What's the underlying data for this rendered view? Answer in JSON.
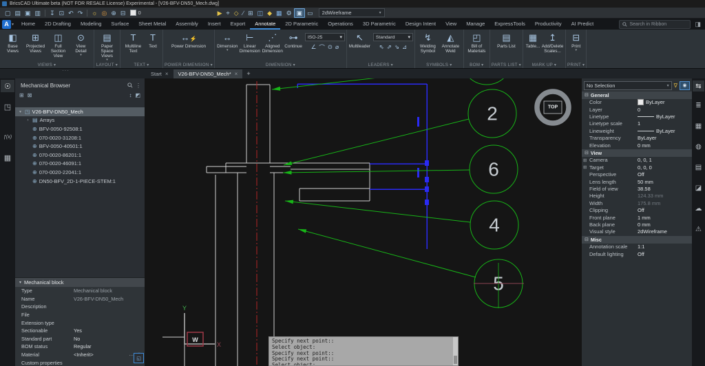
{
  "window": {
    "title": "BricsCAD Ultimate beta (NOT FOR RESALE License) Experimental - [V26-BFV-DN50_Mech.dwg]"
  },
  "qat": {
    "layer_value": "0",
    "visual_style": "2dWireframe",
    "left_icons": [
      {
        "name": "new-file-icon",
        "glyph": "▢"
      },
      {
        "name": "open-file-icon",
        "glyph": "▤"
      },
      {
        "name": "save-icon",
        "glyph": "▣"
      },
      {
        "name": "save-all-icon",
        "glyph": "▥"
      },
      {
        "name": "sep"
      },
      {
        "name": "import-icon",
        "glyph": "↧"
      },
      {
        "name": "export-icon",
        "glyph": "⊡"
      },
      {
        "name": "undo-icon",
        "glyph": "↶"
      },
      {
        "name": "redo-icon",
        "glyph": "↷"
      },
      {
        "name": "sep"
      },
      {
        "name": "tips-icon",
        "glyph": "☼",
        "color": "#e6c04a"
      },
      {
        "name": "target-icon",
        "glyph": "◎",
        "color": "#e09a3e"
      },
      {
        "name": "snap-marker-icon",
        "glyph": "⊕"
      },
      {
        "name": "plot-icon",
        "glyph": "⊟"
      }
    ],
    "right_icons": [
      {
        "name": "cursor-icon",
        "glyph": "▶",
        "color": "#e3c34a"
      },
      {
        "name": "crosshair-icon",
        "glyph": "⌖"
      },
      {
        "name": "entity-snap-icon",
        "glyph": "◇",
        "color": "#e3c34a"
      },
      {
        "name": "sketch-icon",
        "glyph": "∕"
      },
      {
        "name": "grid-icon",
        "glyph": "⊞"
      },
      {
        "name": "panels-icon",
        "glyph": "◫",
        "color": "#7fb2e5"
      },
      {
        "name": "effects-icon",
        "glyph": "◆",
        "color": "#e3c34a"
      },
      {
        "name": "table-icon",
        "glyph": "▦",
        "color": "#7fb2e5"
      },
      {
        "name": "settings-icon",
        "glyph": "⚙"
      },
      {
        "name": "current-view-icon",
        "glyph": "▣",
        "active": true,
        "color": "#cfe2f2"
      },
      {
        "name": "monitor-icon",
        "glyph": "▭"
      }
    ]
  },
  "ribbon": {
    "active_tab": "Annotate",
    "search_placeholder": "Search in Ribbon",
    "tabs": [
      "Home",
      "2D Drafting",
      "Modeling",
      "Surface",
      "Sheet Metal",
      "Assembly",
      "Insert",
      "Export",
      "Annotate",
      "2D Parametric",
      "Operations",
      "3D Parametric",
      "Design Intent",
      "View",
      "Manage",
      "ExpressTools",
      "Productivity",
      "AI Predict"
    ],
    "groups": [
      {
        "label": "VIEWS",
        "buttons": [
          {
            "label": "Base Views",
            "glyph": "◧"
          },
          {
            "label": "Projected Views",
            "glyph": "⊞"
          },
          {
            "label": "Full Section View",
            "glyph": "◫"
          },
          {
            "label": "View Detail",
            "glyph": "⊙",
            "caret": true
          }
        ]
      },
      {
        "label": "LAYOUT",
        "buttons": [
          {
            "label": "Paper Space Views",
            "glyph": "▤",
            "caret": true
          }
        ]
      },
      {
        "label": "TEXT",
        "buttons": [
          {
            "label": "Multiline Text",
            "glyph": "T"
          },
          {
            "label": "Text",
            "glyph": "T"
          }
        ]
      },
      {
        "label": "POWER DIMENSION",
        "buttons": [
          {
            "label": "Power Dimension",
            "glyph": "↔",
            "wide": true,
            "spark": "⚡"
          }
        ]
      },
      {
        "label": "DIMENSION",
        "buttons": [
          {
            "label": "Dimension",
            "glyph": "↔",
            "caret": true
          },
          {
            "label": "Linear Dimension",
            "glyph": "⊢"
          },
          {
            "label": "Aligned Dimension",
            "glyph": "⋰"
          },
          {
            "label": "Continue",
            "glyph": "⊶"
          }
        ],
        "side": {
          "dropdown": "ISO-25",
          "icons": [
            "∠",
            "⌒",
            "⊙",
            "⌀"
          ]
        }
      },
      {
        "label": "LEADERS",
        "buttons": [
          {
            "label": "Multileader",
            "glyph": "↖"
          }
        ],
        "side": {
          "dropdown": "Standard",
          "icons": [
            "⇖",
            "⇗",
            "⇘",
            "⊿"
          ]
        }
      },
      {
        "label": "SYMBOLS",
        "buttons": [
          {
            "label": "Welding Symbol",
            "glyph": "↯"
          },
          {
            "label": "Annotate Weld",
            "glyph": "◭"
          }
        ]
      },
      {
        "label": "BOM",
        "buttons": [
          {
            "label": "Bill of Materials",
            "glyph": "◰"
          }
        ]
      },
      {
        "label": "PARTS LIST",
        "buttons": [
          {
            "label": "Parts List",
            "glyph": "▤"
          }
        ]
      },
      {
        "label": "MARK UP",
        "buttons": [
          {
            "label": "Table...",
            "glyph": "▦"
          },
          {
            "label": "Add/Delete Scales...",
            "glyph": "↥"
          }
        ]
      },
      {
        "label": "PRINT",
        "buttons": [
          {
            "label": "Print",
            "glyph": "⊟",
            "caret": true
          }
        ]
      }
    ]
  },
  "doc_tabs": {
    "add_label": "+",
    "tabs": [
      {
        "label": "Start",
        "active": false
      },
      {
        "label": "V26-BFV-DN50_Mech*",
        "active": true
      }
    ]
  },
  "left_strip": [
    {
      "name": "light-panel-icon",
      "glyph": "☉",
      "active": true,
      "gap": 2
    },
    {
      "name": "solids-browser-icon",
      "glyph": "◳",
      "gap": 12
    },
    {
      "name": "parameters-panel-icon",
      "glyph": "ƒ(x)",
      "small": true,
      "gap": 26
    },
    {
      "name": "structure-panel-icon",
      "glyph": "▦",
      "gap": 12
    }
  ],
  "browser": {
    "title": "Mechanical Browser",
    "tools": [
      {
        "name": "mech-symbols-icon",
        "glyph": "⊞",
        "side": "left"
      },
      {
        "name": "bom-status-icon",
        "glyph": "⊠",
        "side": "left"
      },
      {
        "name": "expand-levels-icon",
        "glyph": "↕",
        "side": "right"
      },
      {
        "name": "highlight-mode-icon",
        "glyph": "◩",
        "side": "right"
      }
    ],
    "tree": [
      {
        "label": "V26-BFV-DN50_Mech",
        "level": 0,
        "icon": "assembly",
        "caret": "▾",
        "selected": true
      },
      {
        "label": "Arrays",
        "level": 1,
        "icon": "folder",
        "caret": "›",
        "selected": false
      },
      {
        "label": "BFV-0050-92508:1",
        "level": 1,
        "icon": "part",
        "caret": "",
        "selected": false
      },
      {
        "label": "070-0020-31208:1",
        "level": 1,
        "icon": "part",
        "caret": "",
        "selected": false
      },
      {
        "label": "BFV-0050-40501:1",
        "level": 1,
        "icon": "part",
        "caret": "",
        "selected": false
      },
      {
        "label": "070-0020-86201:1",
        "level": 1,
        "icon": "part",
        "caret": "",
        "selected": false
      },
      {
        "label": "070-0020-46091:1",
        "level": 1,
        "icon": "part",
        "caret": "",
        "selected": false
      },
      {
        "label": "070-0020-22041:1",
        "level": 1,
        "icon": "part",
        "caret": "",
        "selected": false
      },
      {
        "label": "DN50-BFV_2D-1-PIECE-STEM:1",
        "level": 1,
        "icon": "part",
        "caret": "",
        "selected": false
      }
    ]
  },
  "block_props": {
    "title": "Mechanical block",
    "rows": [
      {
        "label": "Type",
        "value": "Mechanical block",
        "gray": true
      },
      {
        "label": "Name",
        "value": "V26-BFV-DN50_Mech",
        "gray": true
      },
      {
        "label": "Description",
        "value": ""
      },
      {
        "label": "File",
        "value": ""
      },
      {
        "label": "Extension type",
        "value": ""
      },
      {
        "label": "Sectionable",
        "value": "Yes"
      },
      {
        "label": "Standard part",
        "value": "No"
      },
      {
        "label": "BOM status",
        "value": "Regular"
      },
      {
        "label": "Material",
        "value": "<Inherit>",
        "actions": true
      },
      {
        "label": "Custom properties",
        "value": ""
      }
    ]
  },
  "properties": {
    "selection": "No Selection",
    "sections": [
      {
        "title": "General",
        "rows": [
          {
            "label": "Color",
            "value": "ByLayer",
            "swatch": true
          },
          {
            "label": "Layer",
            "value": "0"
          },
          {
            "label": "Linetype",
            "value": "ByLayer",
            "line": true
          },
          {
            "label": "Linetype scale",
            "value": "1"
          },
          {
            "label": "Lineweight",
            "value": "ByLayer",
            "line": true
          },
          {
            "label": "Transparency",
            "value": "ByLayer"
          },
          {
            "label": "Elevation",
            "value": "0 mm"
          }
        ]
      },
      {
        "title": "View",
        "rows": [
          {
            "label": "Camera",
            "value": "0, 0, 1",
            "expand": true
          },
          {
            "label": "Target",
            "value": "0, 0, 0",
            "expand": true
          },
          {
            "label": "Perspective",
            "value": "Off"
          },
          {
            "label": "Lens length",
            "value": "50 mm"
          },
          {
            "label": "Field of view",
            "value": "38.58"
          },
          {
            "label": "Height",
            "value": "124.33 mm",
            "disabled": true
          },
          {
            "label": "Width",
            "value": "175.8 mm",
            "disabled": true
          },
          {
            "label": "Clipping",
            "value": "Off"
          },
          {
            "label": "Front plane",
            "value": "1 mm"
          },
          {
            "label": "Back plane",
            "value": "0 mm"
          },
          {
            "label": "Visual style",
            "value": "2dWireframe"
          }
        ]
      },
      {
        "title": "Misc",
        "rows": [
          {
            "label": "Annotation scale",
            "value": "1:1"
          },
          {
            "label": "Default lighting",
            "value": "Off"
          }
        ]
      }
    ]
  },
  "right_strip": [
    {
      "name": "properties-panel-icon",
      "glyph": "⇆",
      "active": true
    },
    {
      "name": "layers-panel-icon",
      "glyph": "≣"
    },
    {
      "name": "blocks-panel-icon",
      "glyph": "▦"
    },
    {
      "name": "assistant-panel-icon",
      "glyph": "◍"
    },
    {
      "name": "table-panel-icon",
      "glyph": "▤"
    },
    {
      "name": "sheets-panel-icon",
      "glyph": "◪"
    },
    {
      "name": "cloud-panel-icon",
      "glyph": "☁"
    },
    {
      "name": "warnings-panel-icon",
      "glyph": "⚠"
    }
  ],
  "command_line": {
    "lines": [
      "Specify next point::",
      "Select object:",
      "Specify next point::",
      "Specify next point::",
      "Select object:"
    ]
  },
  "canvas": {
    "view_label": "TOP",
    "balloons": [
      "2",
      "6",
      "4",
      "5"
    ],
    "ucs": {
      "x": "X",
      "y": "Y",
      "w": "W"
    },
    "colors": {
      "geometry": "#cfcfcf",
      "centerline": "#b32525",
      "dimension": "#2a2af5",
      "leader": "#17b517",
      "crosshair": "#8c4452"
    }
  }
}
